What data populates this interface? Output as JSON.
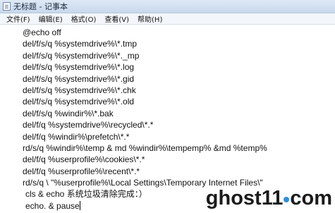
{
  "window": {
    "title": "无标题 - 记事本"
  },
  "menu": {
    "items": [
      {
        "label": "文件(F)"
      },
      {
        "label": "编辑(E)"
      },
      {
        "label": "格式(O)"
      },
      {
        "label": "查看(V)"
      },
      {
        "label": "帮助(H)"
      }
    ]
  },
  "editor": {
    "lines": [
      "@echo off",
      "del/f/s/q %systemdrive%\\*.tmp",
      "del/f/s/q %systemdrive%\\*._mp",
      "del/f/s/q %systemdrive%\\*.log",
      "del/f/s/q %systemdrive%\\*.gid",
      "del/f/s/q %systemdrive%\\*.chk",
      "del/f/s/q %systemdrive%\\*.old",
      "del/f/s/q %windir%\\*.bak",
      "del/f/q %systemdrive%\\recycled\\*.*",
      "del/f/q %windir%\\prefetch\\*.*",
      "rd/s/q %windir%\\temp & md %windir%\\tempemp% &md %temp%",
      "del/f/q %userprofile%\\cookies\\*.*",
      "del/f/q %userprofile%\\recent\\*.*",
      "rd/s/q \\ \"%userprofile%\\Local Settings\\Temporary Internet Files\\\"",
      "cls & echo 系统垃圾清除完成：）",
      "echo. & pause"
    ]
  },
  "watermark": {
    "brand_prefix": "ghost11",
    "brand_suffix": "com",
    "dot_color": "#2f8fd8"
  },
  "icons": {
    "app": "notepad-icon"
  }
}
